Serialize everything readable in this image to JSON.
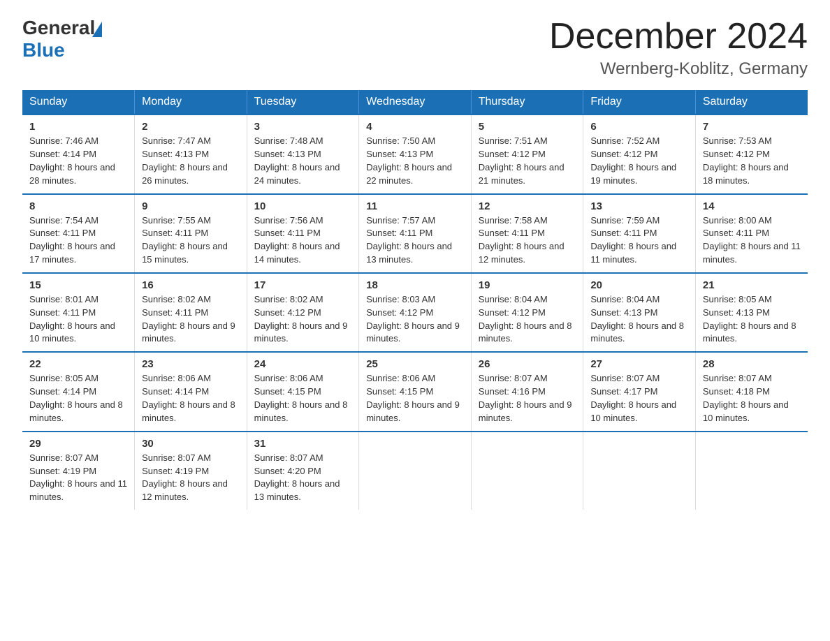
{
  "header": {
    "logo_general": "General",
    "logo_blue": "Blue",
    "title": "December 2024",
    "subtitle": "Wernberg-Koblitz, Germany"
  },
  "weekdays": [
    "Sunday",
    "Monday",
    "Tuesday",
    "Wednesday",
    "Thursday",
    "Friday",
    "Saturday"
  ],
  "weeks": [
    [
      {
        "day": "1",
        "sunrise": "Sunrise: 7:46 AM",
        "sunset": "Sunset: 4:14 PM",
        "daylight": "Daylight: 8 hours and 28 minutes."
      },
      {
        "day": "2",
        "sunrise": "Sunrise: 7:47 AM",
        "sunset": "Sunset: 4:13 PM",
        "daylight": "Daylight: 8 hours and 26 minutes."
      },
      {
        "day": "3",
        "sunrise": "Sunrise: 7:48 AM",
        "sunset": "Sunset: 4:13 PM",
        "daylight": "Daylight: 8 hours and 24 minutes."
      },
      {
        "day": "4",
        "sunrise": "Sunrise: 7:50 AM",
        "sunset": "Sunset: 4:13 PM",
        "daylight": "Daylight: 8 hours and 22 minutes."
      },
      {
        "day": "5",
        "sunrise": "Sunrise: 7:51 AM",
        "sunset": "Sunset: 4:12 PM",
        "daylight": "Daylight: 8 hours and 21 minutes."
      },
      {
        "day": "6",
        "sunrise": "Sunrise: 7:52 AM",
        "sunset": "Sunset: 4:12 PM",
        "daylight": "Daylight: 8 hours and 19 minutes."
      },
      {
        "day": "7",
        "sunrise": "Sunrise: 7:53 AM",
        "sunset": "Sunset: 4:12 PM",
        "daylight": "Daylight: 8 hours and 18 minutes."
      }
    ],
    [
      {
        "day": "8",
        "sunrise": "Sunrise: 7:54 AM",
        "sunset": "Sunset: 4:11 PM",
        "daylight": "Daylight: 8 hours and 17 minutes."
      },
      {
        "day": "9",
        "sunrise": "Sunrise: 7:55 AM",
        "sunset": "Sunset: 4:11 PM",
        "daylight": "Daylight: 8 hours and 15 minutes."
      },
      {
        "day": "10",
        "sunrise": "Sunrise: 7:56 AM",
        "sunset": "Sunset: 4:11 PM",
        "daylight": "Daylight: 8 hours and 14 minutes."
      },
      {
        "day": "11",
        "sunrise": "Sunrise: 7:57 AM",
        "sunset": "Sunset: 4:11 PM",
        "daylight": "Daylight: 8 hours and 13 minutes."
      },
      {
        "day": "12",
        "sunrise": "Sunrise: 7:58 AM",
        "sunset": "Sunset: 4:11 PM",
        "daylight": "Daylight: 8 hours and 12 minutes."
      },
      {
        "day": "13",
        "sunrise": "Sunrise: 7:59 AM",
        "sunset": "Sunset: 4:11 PM",
        "daylight": "Daylight: 8 hours and 11 minutes."
      },
      {
        "day": "14",
        "sunrise": "Sunrise: 8:00 AM",
        "sunset": "Sunset: 4:11 PM",
        "daylight": "Daylight: 8 hours and 11 minutes."
      }
    ],
    [
      {
        "day": "15",
        "sunrise": "Sunrise: 8:01 AM",
        "sunset": "Sunset: 4:11 PM",
        "daylight": "Daylight: 8 hours and 10 minutes."
      },
      {
        "day": "16",
        "sunrise": "Sunrise: 8:02 AM",
        "sunset": "Sunset: 4:11 PM",
        "daylight": "Daylight: 8 hours and 9 minutes."
      },
      {
        "day": "17",
        "sunrise": "Sunrise: 8:02 AM",
        "sunset": "Sunset: 4:12 PM",
        "daylight": "Daylight: 8 hours and 9 minutes."
      },
      {
        "day": "18",
        "sunrise": "Sunrise: 8:03 AM",
        "sunset": "Sunset: 4:12 PM",
        "daylight": "Daylight: 8 hours and 9 minutes."
      },
      {
        "day": "19",
        "sunrise": "Sunrise: 8:04 AM",
        "sunset": "Sunset: 4:12 PM",
        "daylight": "Daylight: 8 hours and 8 minutes."
      },
      {
        "day": "20",
        "sunrise": "Sunrise: 8:04 AM",
        "sunset": "Sunset: 4:13 PM",
        "daylight": "Daylight: 8 hours and 8 minutes."
      },
      {
        "day": "21",
        "sunrise": "Sunrise: 8:05 AM",
        "sunset": "Sunset: 4:13 PM",
        "daylight": "Daylight: 8 hours and 8 minutes."
      }
    ],
    [
      {
        "day": "22",
        "sunrise": "Sunrise: 8:05 AM",
        "sunset": "Sunset: 4:14 PM",
        "daylight": "Daylight: 8 hours and 8 minutes."
      },
      {
        "day": "23",
        "sunrise": "Sunrise: 8:06 AM",
        "sunset": "Sunset: 4:14 PM",
        "daylight": "Daylight: 8 hours and 8 minutes."
      },
      {
        "day": "24",
        "sunrise": "Sunrise: 8:06 AM",
        "sunset": "Sunset: 4:15 PM",
        "daylight": "Daylight: 8 hours and 8 minutes."
      },
      {
        "day": "25",
        "sunrise": "Sunrise: 8:06 AM",
        "sunset": "Sunset: 4:15 PM",
        "daylight": "Daylight: 8 hours and 9 minutes."
      },
      {
        "day": "26",
        "sunrise": "Sunrise: 8:07 AM",
        "sunset": "Sunset: 4:16 PM",
        "daylight": "Daylight: 8 hours and 9 minutes."
      },
      {
        "day": "27",
        "sunrise": "Sunrise: 8:07 AM",
        "sunset": "Sunset: 4:17 PM",
        "daylight": "Daylight: 8 hours and 10 minutes."
      },
      {
        "day": "28",
        "sunrise": "Sunrise: 8:07 AM",
        "sunset": "Sunset: 4:18 PM",
        "daylight": "Daylight: 8 hours and 10 minutes."
      }
    ],
    [
      {
        "day": "29",
        "sunrise": "Sunrise: 8:07 AM",
        "sunset": "Sunset: 4:19 PM",
        "daylight": "Daylight: 8 hours and 11 minutes."
      },
      {
        "day": "30",
        "sunrise": "Sunrise: 8:07 AM",
        "sunset": "Sunset: 4:19 PM",
        "daylight": "Daylight: 8 hours and 12 minutes."
      },
      {
        "day": "31",
        "sunrise": "Sunrise: 8:07 AM",
        "sunset": "Sunset: 4:20 PM",
        "daylight": "Daylight: 8 hours and 13 minutes."
      },
      {
        "day": "",
        "sunrise": "",
        "sunset": "",
        "daylight": ""
      },
      {
        "day": "",
        "sunrise": "",
        "sunset": "",
        "daylight": ""
      },
      {
        "day": "",
        "sunrise": "",
        "sunset": "",
        "daylight": ""
      },
      {
        "day": "",
        "sunrise": "",
        "sunset": "",
        "daylight": ""
      }
    ]
  ]
}
